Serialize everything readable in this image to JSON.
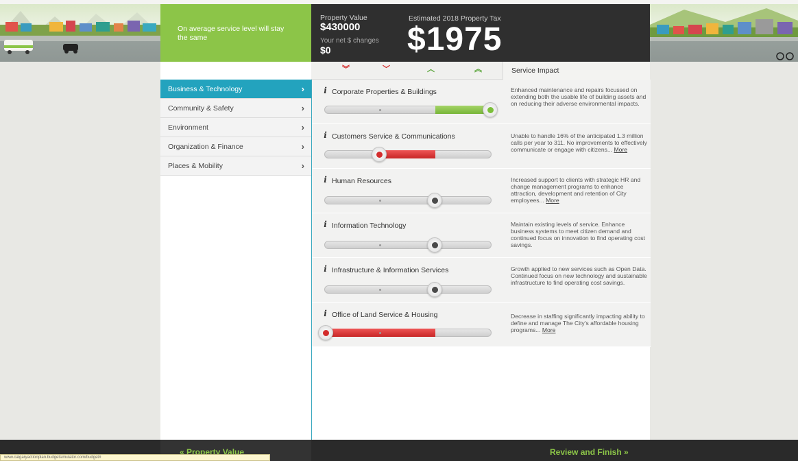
{
  "header": {
    "message": "On average service level will stay the same",
    "property_value_label": "Property Value",
    "property_value": "$430000",
    "net_changes_label": "Your net $ changes",
    "net_changes_value": "$0",
    "tax_label": "Estimated 2018 Property Tax",
    "tax_value": "$1975"
  },
  "columns": {
    "service_impact_label": "Service Impact",
    "arrows": [
      "double-down-arrow-icon",
      "down-arrow-icon",
      "up-arrow-icon",
      "double-up-arrow-icon"
    ]
  },
  "nav": {
    "items": [
      {
        "label": "Business & Technology",
        "active": true
      },
      {
        "label": "Community & Safety",
        "active": false
      },
      {
        "label": "Environment",
        "active": false
      },
      {
        "label": "Organization & Finance",
        "active": false
      },
      {
        "label": "Places & Mobility",
        "active": false
      }
    ]
  },
  "services": [
    {
      "title": "Corporate Properties & Buildings",
      "level": 1.0,
      "impact": "Enhanced maintenance and repairs focussed on extending both the usable life of building assets and on reducing their adverse environmental impacts.",
      "more": ""
    },
    {
      "title": "Customers Service & Communications",
      "level": 0.33,
      "impact": "Unable to handle 16% of the anticipated 1.3 million calls per year to 311. No improvements to effectively communicate or engage with citizens...",
      "more": "More"
    },
    {
      "title": "Human Resources",
      "level": 0.67,
      "impact": "Increased support to clients with strategic HR and change management programs to enhance attraction, development and retention of City employees...",
      "more": "More"
    },
    {
      "title": "Information Technology",
      "level": 0.67,
      "impact": "Maintain existing levels of service. Enhance business systems to meet citizen demand and continued focus on innovation to find operating cost savings.",
      "more": ""
    },
    {
      "title": "Infrastructure & Information Services",
      "level": 0.67,
      "impact": "Growth applied to new services such as Open Data. Continued focus on new technology and sustainable infrastructure to find operating cost savings.",
      "more": ""
    },
    {
      "title": "Office of Land Service & Housing",
      "level": 0.0,
      "impact": "Decrease in staffing significantly impacting ability to define and manage The City's affordable housing programs...",
      "more": "More"
    }
  ],
  "footer": {
    "prev_label": "« Property Value",
    "next_label": "Review and Finish »",
    "status_url": "www.calgaryactionplan.budgetsimulator.com/budget#"
  },
  "colors": {
    "accent_green": "#8cc548",
    "nav_active": "#23a3be",
    "decrease_red": "#d32c2c",
    "dark_panel": "#2f2f2f"
  }
}
